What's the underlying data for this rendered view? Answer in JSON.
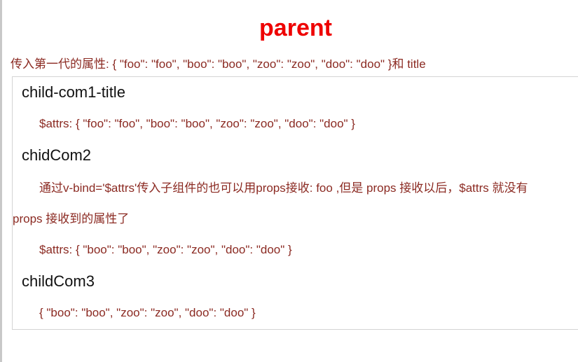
{
  "parent": {
    "title": "parent",
    "attrs_line": "传入第一代的属性: { \"foo\": \"foo\", \"boo\": \"boo\", \"zoo\": \"zoo\", \"doo\": \"doo\" }和 title"
  },
  "child1": {
    "title": "child-com1-title",
    "attrs_line": "$attrs:  { \"foo\": \"foo\", \"boo\": \"boo\", \"zoo\": \"zoo\", \"doo\": \"doo\" }"
  },
  "child2": {
    "title": "chidCom2",
    "note_line1": "通过v-bind='$attrs'传入子组件的也可以用props接收: foo ,但是 props 接收以后，$attrs 就没有",
    "note_line2": "props 接收到的属性了",
    "attrs_line": "$attrs: { \"boo\": \"boo\", \"zoo\": \"zoo\", \"doo\": \"doo\" }"
  },
  "child3": {
    "title": "childCom3",
    "attrs_line": "{ \"boo\": \"boo\", \"zoo\": \"zoo\", \"doo\": \"doo\" }"
  },
  "colors": {
    "title": "#ee0000",
    "text": "#8b2a22",
    "heading": "#111111",
    "border": "#d4d4d4"
  }
}
